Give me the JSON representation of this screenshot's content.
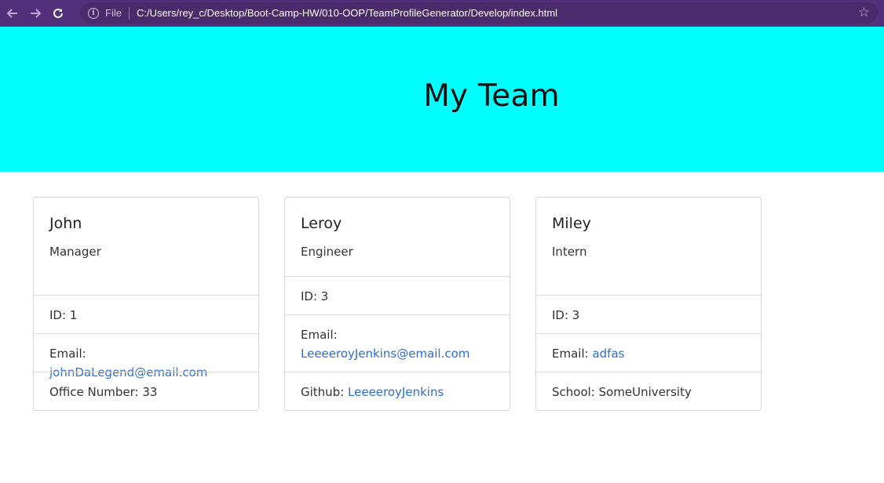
{
  "browser": {
    "file_label": "File",
    "url": "C:/Users/rey_c/Desktop/Boot-Camp-HW/010-OOP/TeamProfileGenerator/Develop/index.html"
  },
  "header": {
    "title": "My Team"
  },
  "cards": [
    {
      "name": "John",
      "role": "Manager",
      "id_text": "ID: 1",
      "email_label": "Email: ",
      "email": "johnDaLegend@email.com",
      "extra_label": "Office Number: 33",
      "extra_link": ""
    },
    {
      "name": "Leroy",
      "role": "Engineer",
      "id_text": "ID: 3",
      "email_label": "Email:",
      "email": "LeeeeroyJenkins@email.com",
      "extra_label": "Github: ",
      "extra_link": "LeeeeroyJenkins"
    },
    {
      "name": "Miley",
      "role": "Intern",
      "id_text": "ID: 3",
      "email_label": "Email: ",
      "email": "adfas",
      "extra_label": "School: SomeUniversity",
      "extra_link": ""
    }
  ],
  "colors": {
    "chrome": "#54307b",
    "hero": "#00ffff",
    "link": "#2a6fdb"
  }
}
